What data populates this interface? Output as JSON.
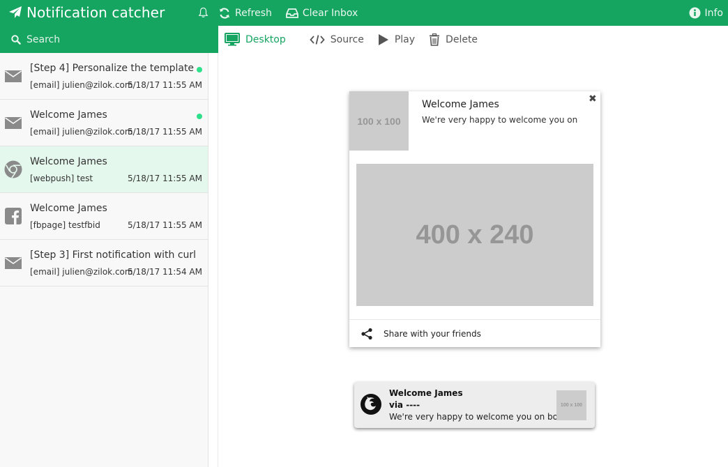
{
  "app": {
    "title": "Notification catcher",
    "accent_color": "#16a461",
    "unread_dot_color": "#2fe08b"
  },
  "header": {
    "refresh_label": "Refresh",
    "clear_inbox_label": "Clear Inbox",
    "info_label": "Info"
  },
  "search": {
    "placeholder": "Search",
    "value": ""
  },
  "toolbar": {
    "desktop_label": "Desktop",
    "source_label": "Source",
    "play_label": "Play",
    "delete_label": "Delete"
  },
  "inbox": {
    "items": [
      {
        "icon": "envelope-icon",
        "subject": "[Step 4] Personalize the template",
        "meta": "[email] julien@zilok.com",
        "date": "5/18/17 11:55 AM",
        "unread": true,
        "selected": false
      },
      {
        "icon": "envelope-icon",
        "subject": "Welcome James",
        "meta": "[email] julien@zilok.com",
        "date": "5/18/17 11:55 AM",
        "unread": true,
        "selected": false
      },
      {
        "icon": "chrome-icon",
        "subject": "Welcome James",
        "meta": "[webpush] test",
        "date": "5/18/17 11:55 AM",
        "unread": false,
        "selected": true
      },
      {
        "icon": "facebook-icon",
        "subject": "Welcome James",
        "meta": "[fbpage] testfbid",
        "date": "5/18/17 11:55 AM",
        "unread": false,
        "selected": false
      },
      {
        "icon": "envelope-icon",
        "subject": "[Step 3] First notification with curl",
        "meta": "[email] julien@zilok.com",
        "date": "5/18/17 11:54 AM",
        "unread": false,
        "selected": false
      }
    ]
  },
  "preview": {
    "thumb_label": "100 x 100",
    "title": "Welcome James",
    "body": "We're very happy to welcome you on",
    "image_label": "400 x 240",
    "share_label": "Share with your friends"
  },
  "toast": {
    "title": "Welcome James",
    "via": "via ----",
    "body": "We're very happy to welcome you on bo..",
    "thumb_label": "100 x 100"
  }
}
